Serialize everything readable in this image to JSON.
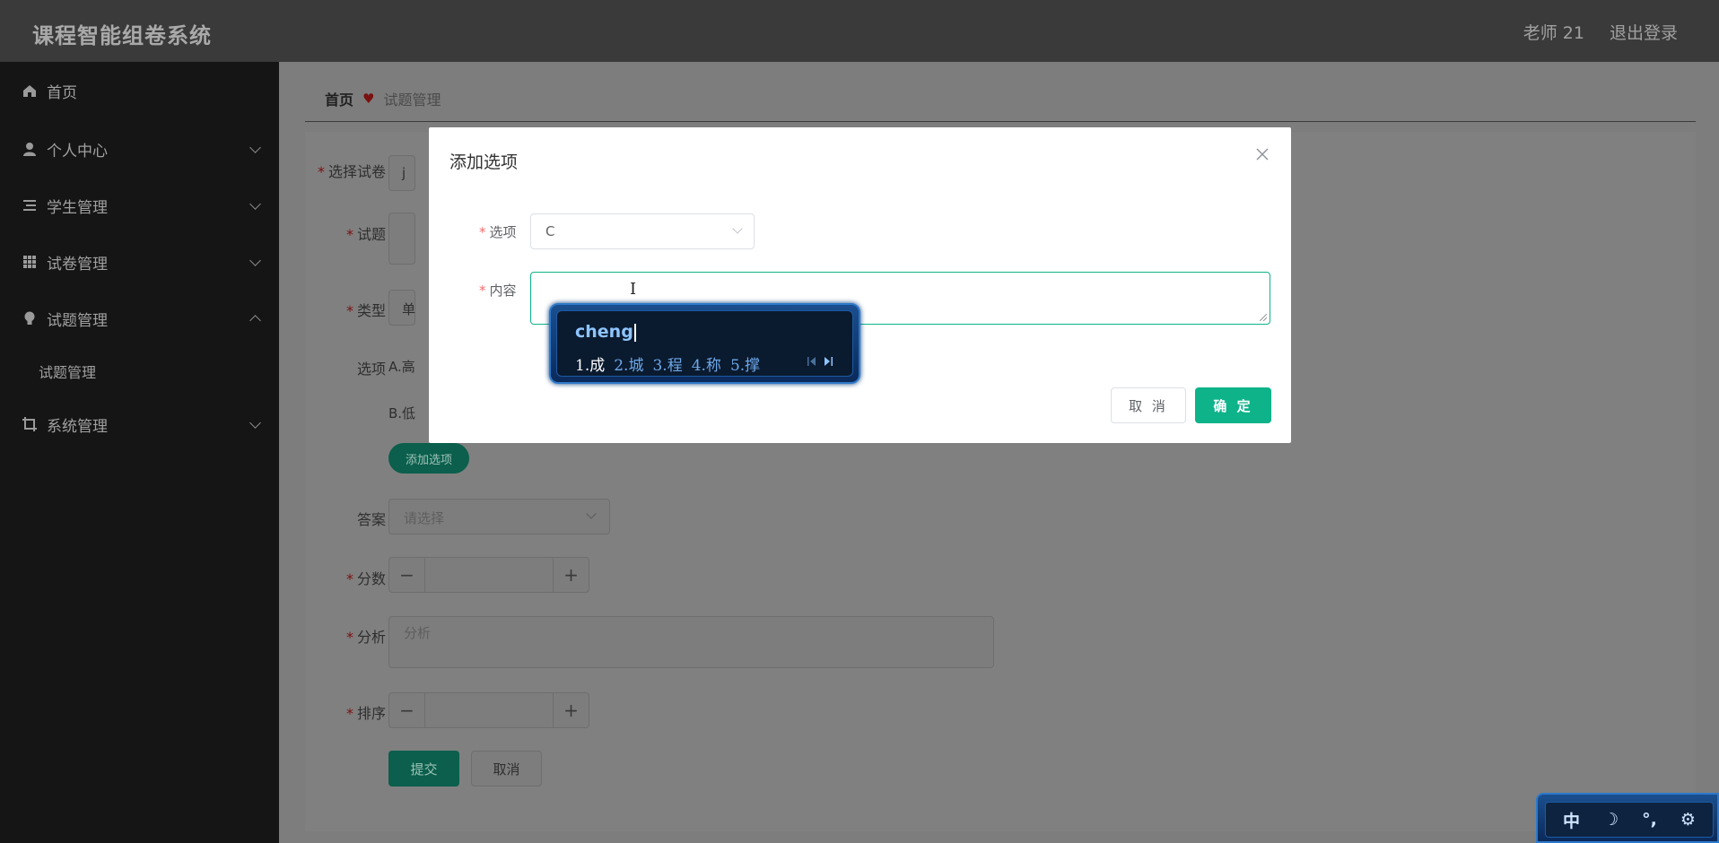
{
  "header": {
    "title": "课程智能组卷系统",
    "user": "老师 21",
    "logout": "退出登录"
  },
  "sidebar": {
    "items": [
      {
        "label": "首页",
        "icon": "home-icon"
      },
      {
        "label": "个人中心",
        "icon": "user-icon"
      },
      {
        "label": "学生管理",
        "icon": "list-icon"
      },
      {
        "label": "试卷管理",
        "icon": "grid-icon"
      },
      {
        "label": "试题管理",
        "icon": "bulb-icon",
        "expanded": true
      },
      {
        "label": "系统管理",
        "icon": "crop-icon"
      }
    ],
    "subitem": "试题管理"
  },
  "breadcrumb": {
    "home": "首页",
    "current": "试题管理"
  },
  "form": {
    "paper_label": "选择试卷",
    "paper_value": "j",
    "question_label": "试题",
    "type_label": "类型",
    "type_value": "单",
    "options_label": "选项",
    "option_a": "A.高",
    "option_b": "B.低",
    "add_option_button": "添加选项",
    "answer_label": "答案",
    "answer_placeholder": "请选择",
    "score_label": "分数",
    "analysis_label": "分析",
    "analysis_placeholder": "分析",
    "order_label": "排序",
    "submit_button": "提交",
    "cancel_button": "取消"
  },
  "dialog": {
    "title": "添加选项",
    "option_label": "选项",
    "option_value": "C",
    "content_label": "内容",
    "cancel_button": "取 消",
    "ok_button": "确 定"
  },
  "ime": {
    "pinyin": "cheng",
    "candidates": [
      "1.成",
      "2.城",
      "3.程",
      "4.称",
      "5.撑"
    ],
    "status": {
      "lang": "中",
      "moon": "☽",
      "punct": "°,",
      "settings": "⚙"
    }
  },
  "colors": {
    "accent": "#0eb38a",
    "header_bg": "#3a3a3a",
    "sidebar_bg": "#151515",
    "required": "#f56c6c"
  }
}
